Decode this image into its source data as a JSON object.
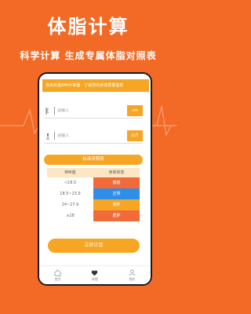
{
  "hero": {
    "title": "体脂计算",
    "subtitle": "科学计算 生成专属体脂对照表"
  },
  "app": {
    "header_title": "身高体重BMI计算器 - 了解您的身体质量指数",
    "height": {
      "placeholder": "请输入",
      "unit": "cm"
    },
    "weight": {
      "placeholder": "请输入",
      "unit": "公斤"
    },
    "reference_button": "标准对照表",
    "table": {
      "headers": [
        "BMI值",
        "身体状态"
      ],
      "rows": [
        {
          "range": "<18.5",
          "status": "偏瘦",
          "color": "#F26A3A"
        },
        {
          "range": "18.5~23.9",
          "status": "正常",
          "color": "#2F8EE8"
        },
        {
          "range": "24~27.9",
          "status": "偏胖",
          "color": "#F6A623"
        },
        {
          "range": "≥28",
          "status": "肥胖",
          "color": "#F26A3A"
        }
      ]
    },
    "calculate_button": "立即计算",
    "tabs": [
      {
        "label": "首页",
        "icon": "home-icon"
      },
      {
        "label": "体脂",
        "icon": "heart-icon"
      },
      {
        "label": "我的",
        "icon": "user-icon"
      }
    ]
  }
}
